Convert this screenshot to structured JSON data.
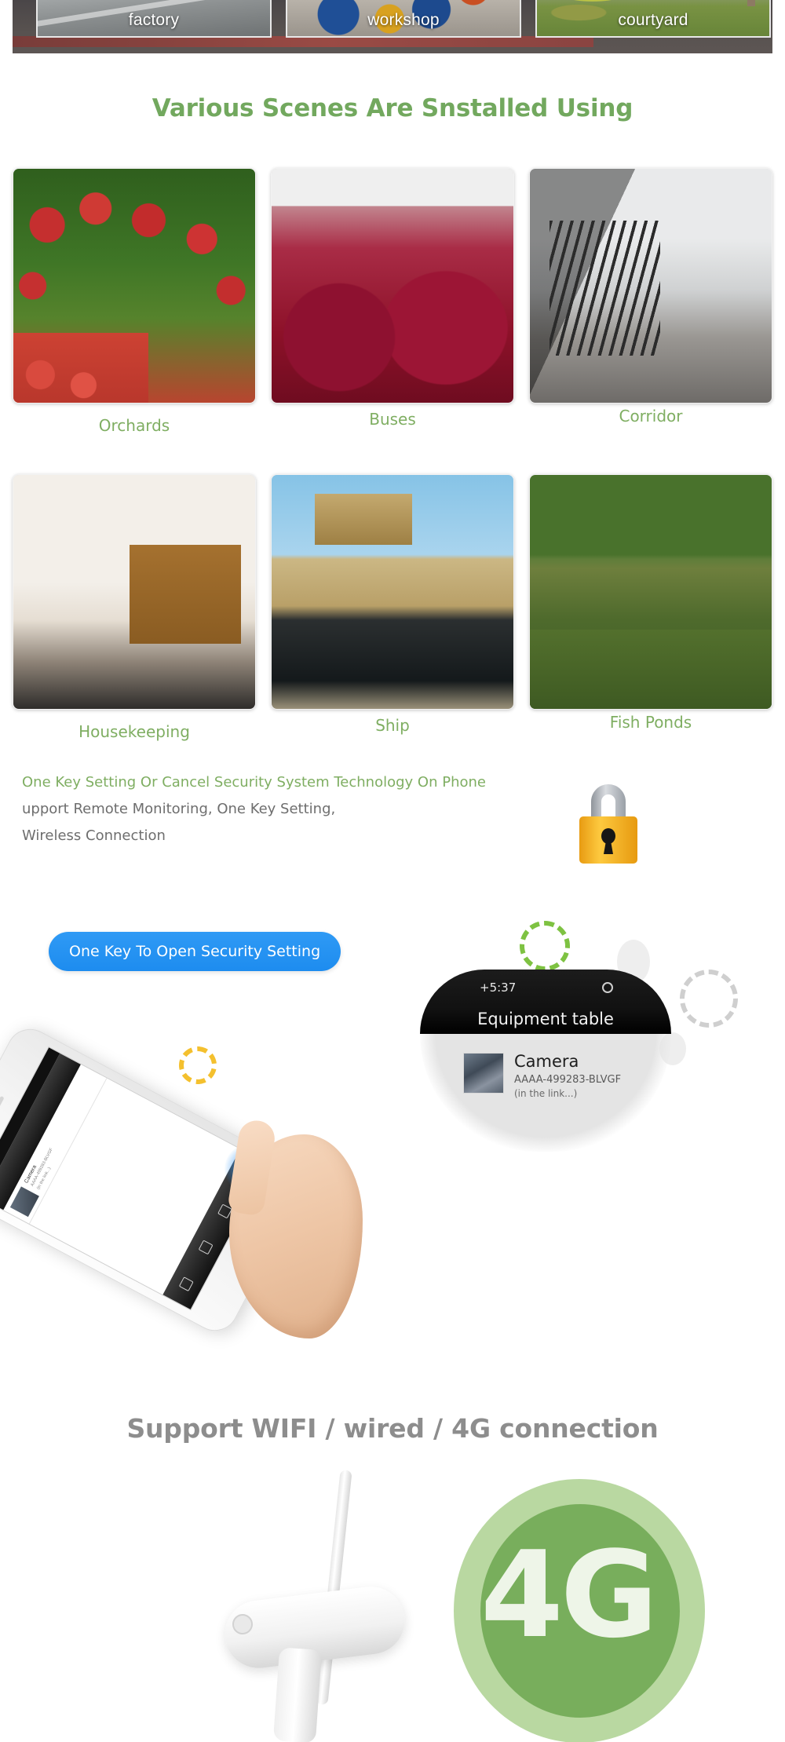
{
  "banner": {
    "tiles": [
      {
        "label": "factory",
        "icon": "factory-photo"
      },
      {
        "label": "workshop",
        "icon": "workshop-photo"
      },
      {
        "label": "courtyard",
        "icon": "courtyard-photo"
      }
    ]
  },
  "scenes_section": {
    "heading": "Various Scenes Are Snstalled Using",
    "heading_color": "#72a85e",
    "label_color": "#7fae62",
    "row1": [
      {
        "label": "Orchards",
        "icon": "orchard-photo"
      },
      {
        "label": "Buses",
        "icon": "bus-interior-photo"
      },
      {
        "label": "Corridor",
        "icon": "corridor-photo"
      }
    ],
    "row2": [
      {
        "label": "Housekeeping",
        "icon": "living-room-photo"
      },
      {
        "label": "Ship",
        "icon": "ship-photo"
      },
      {
        "label": "Fish Ponds",
        "icon": "fish-pond-photo"
      }
    ]
  },
  "feature": {
    "title": "One Key Setting Or Cancel Security System Technology On Phone",
    "line2": "upport Remote Monitoring, One Key Setting,",
    "line3": "Wireless Connection",
    "lock_icon": "padlock-icon",
    "lock_body_color": "#f5b820",
    "lock_shackle_color": "#b9bcc1"
  },
  "security_panel": {
    "button_label": "One Key To Open Security Setting",
    "button_color": "#1d8cef",
    "equipment": {
      "time": "+5:37",
      "title": "Equipment table",
      "settings_icon": "gear-icon"
    },
    "device": {
      "name": "Camera",
      "id": "AAAA-499283-BLVGF",
      "status": "(in the link...)",
      "thumb_icon": "camera-preview-thumbnail"
    },
    "phone_icon": "smartphone-illustration",
    "hand_icon": "pointing-hand-illustration",
    "decor_icons": [
      "green-gear-icon",
      "gray-gear-icon",
      "yellow-gear-icon",
      "small-green-gear-icon"
    ]
  },
  "connection_section": {
    "heading": "Support WIFI / wired / 4G connection",
    "heading_color": "#8d8d8d",
    "badge_text": "4G",
    "badge_color": "#78ae5c",
    "badge_halo_color": "#b9d8a1",
    "camera_icon": "wifi-camera-illustration"
  }
}
